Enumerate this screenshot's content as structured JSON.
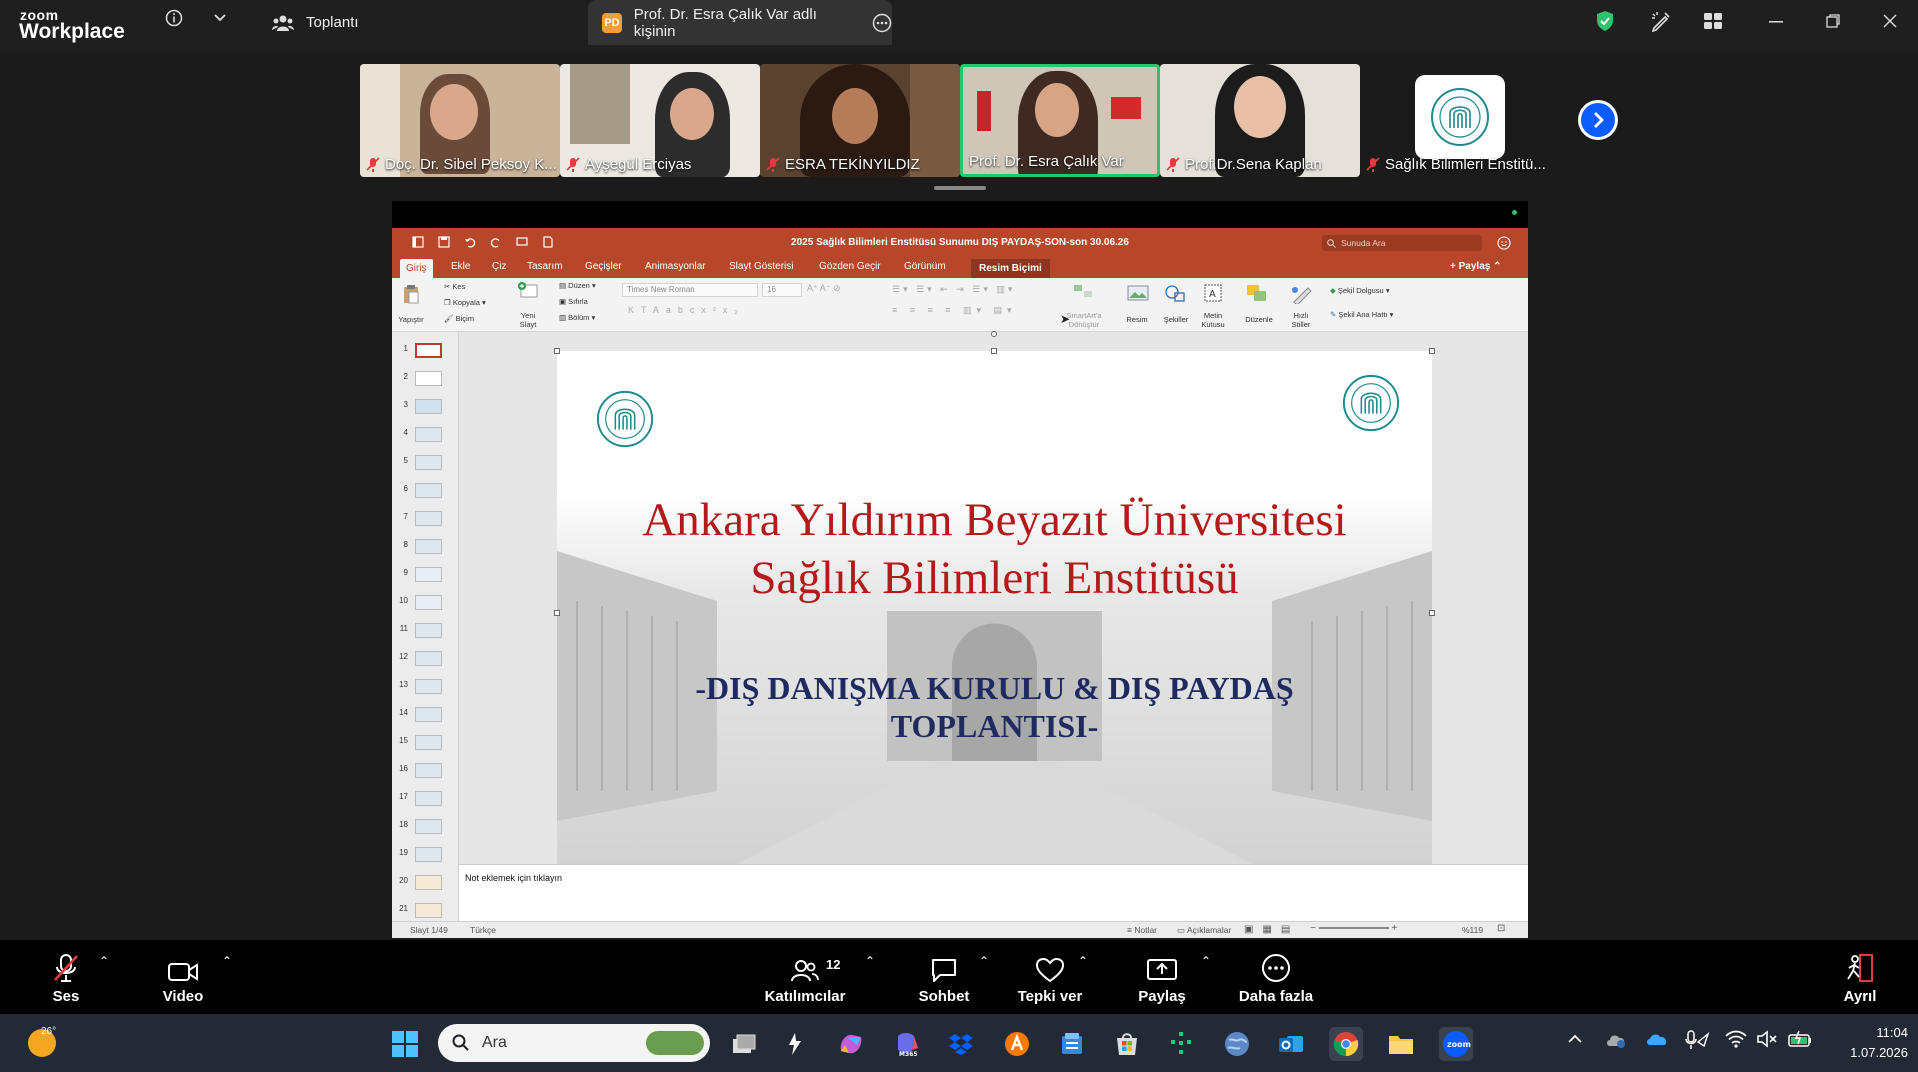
{
  "app": {
    "brand_top": "zoom",
    "brand_bottom": "Workplace"
  },
  "tabs": [
    {
      "label": "Toplantı"
    },
    {
      "badge": "PD",
      "label": "Prof. Dr. Esra Çalık Var adlı kişinin"
    }
  ],
  "participants": [
    {
      "name": "Doç. Dr. Sibel Peksoy K..."
    },
    {
      "name": "Ayşegül Erciyas"
    },
    {
      "name": "ESRA TEKİNYILDIZ"
    },
    {
      "name": "Prof. Dr. Esra Çalık Var"
    },
    {
      "name": "Prof.Dr.Sena Kaplan"
    },
    {
      "name": "Sağlık Bilimleri Enstitü..."
    }
  ],
  "powerpoint": {
    "doc_title": "2025 Sağlık Bilimleri Enstitüsü Sunumu DIŞ PAYDAŞ-SON-son 30.06.26",
    "search_placeholder": "Sunuda Ara",
    "tabs": [
      "Giriş",
      "Ekle",
      "Çiz",
      "Tasarım",
      "Geçişler",
      "Animasyonlar",
      "Slayt Gösterisi",
      "Gözden Geçir",
      "Görünüm",
      "Resim Biçimi"
    ],
    "share_label": "Paylaş",
    "ribbon": {
      "paste": "Yapıştır",
      "cut": "Kes",
      "copy": "Kopyala",
      "format": "Biçim",
      "new_slide_1": "Yeni",
      "new_slide_2": "Slayt",
      "layout": "Düzen",
      "reset": "Sıfırla",
      "section": "Bölüm",
      "font": "Times New Roman",
      "font_size": "16",
      "smartart_1": "SmartArt'a",
      "smartart_2": "Dönüştür",
      "picture": "Resim",
      "shapes": "Şekiller",
      "textbox_1": "Metin",
      "textbox_2": "Kutusu",
      "arrange": "Düzenle",
      "quick_styles_1": "Hızlı",
      "quick_styles_2": "Stiller",
      "shape_fill": "Şekil Dolgusu",
      "shape_outline": "Şekil Ana Hattı"
    },
    "slide_numbers": [
      "1",
      "2",
      "3",
      "4",
      "5",
      "6",
      "7",
      "8",
      "9",
      "10",
      "11",
      "12",
      "13",
      "14",
      "15",
      "16",
      "17",
      "18",
      "19",
      "20",
      "21"
    ],
    "slide": {
      "title_line1": "Ankara Yıldırım Beyazıt Üniversitesi",
      "title_line2": "Sağlık Bilimleri Enstitüsü",
      "subtitle_line1": "-DIŞ DANIŞMA KURULU & DIŞ PAYDAŞ",
      "subtitle_line2": "TOPLANTISI-"
    },
    "notes_placeholder": "Not eklemek için tıklayın",
    "status": {
      "slide_pos": "Slayt 1/49",
      "language": "Türkçe",
      "notes": "Notlar",
      "comments": "Açıklamalar",
      "zoom": "%119"
    }
  },
  "controls": {
    "audio": "Ses",
    "video": "Video",
    "participants": "Katılımcılar",
    "participants_count": "12",
    "chat": "Sohbet",
    "react": "Tepki ver",
    "share": "Paylaş",
    "more": "Daha fazla",
    "leave": "Ayrıl"
  },
  "taskbar": {
    "weather_temp": "26°",
    "search_placeholder": "Ara",
    "time": "11:04",
    "date": "1.07.2026",
    "apps": [
      "windows-start",
      "search",
      "task-view",
      "copilot",
      "microsoft-365",
      "dropbox",
      "avast",
      "news",
      "microsoft-store",
      "connect",
      "earth-app",
      "outlook",
      "chrome",
      "file-explorer",
      "zoom"
    ]
  },
  "colors": {
    "ppt_accent": "#b7472a",
    "title_red": "#b31b1b",
    "subtitle_navy": "#1f2a60",
    "active_speaker": "#2dc26b",
    "muted_red": "#e03e3e",
    "zoom_blue": "#0b5cff"
  }
}
